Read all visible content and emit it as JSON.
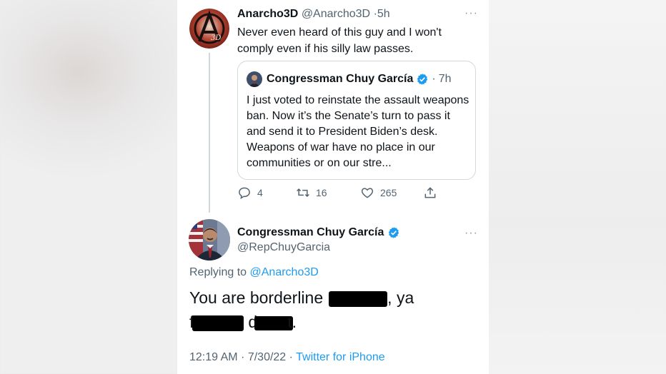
{
  "original_tweet": {
    "display_name": "Anarcho3D",
    "handle": "@Anarcho3D",
    "separator": "·",
    "time_ago": "5h",
    "text": "Never even heard of this guy and I won't comply even if his silly law passes.",
    "avatar_label": "3D",
    "more_label": "···"
  },
  "quoted_tweet": {
    "display_name": "Congressman Chuy García",
    "separator": "·",
    "time_ago": "7h",
    "text": "I just voted to reinstate the assault weapons ban. Now it’s the Senate’s turn to pass it and send it to President Biden’s desk. Weapons of war have no place in our communities or on our stre..."
  },
  "actions": {
    "replies": "4",
    "retweets": "16",
    "likes": "265",
    "icons": [
      "reply-icon",
      "retweet-icon",
      "like-icon",
      "share-icon"
    ]
  },
  "reply_tweet": {
    "display_name": "Congressman Chuy García",
    "handle": "@RepChuyGarcia",
    "more_label": "···",
    "replying_prefix": "Replying to",
    "replying_handle": "@Anarcho3D",
    "text_part1": "You are borderline r",
    "text_part2": ", ya",
    "text_part3": "f",
    "text_part4": "d",
    "text_part5": "t.",
    "timestamp": "12:19 AM · 7/30/22 · ",
    "source": "Twitter for iPhone"
  },
  "colors": {
    "accent": "#1d9bf0",
    "text": "#0f1419",
    "muted": "#536471",
    "border": "#cfd9de",
    "redaction": "#000000"
  }
}
